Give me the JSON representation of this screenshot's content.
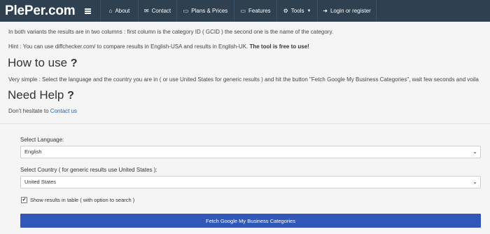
{
  "nav": {
    "brand": "PlePer.com",
    "items": [
      {
        "icon": "home-icon",
        "glyph": "⌂",
        "label": "About"
      },
      {
        "icon": "envelope-icon",
        "glyph": "✉",
        "label": "Contact"
      },
      {
        "icon": "money-icon",
        "glyph": "▭",
        "label": "Plans & Prices"
      },
      {
        "icon": "monitor-icon",
        "glyph": "▭",
        "label": "Features"
      },
      {
        "icon": "cogs-icon",
        "glyph": "⚙",
        "label": "Tools"
      },
      {
        "icon": "login-icon",
        "glyph": "➜",
        "label": "Login or register"
      }
    ]
  },
  "intro": {
    "line1": "In both variants the results are in two columns : first column is the category ID ( GCID ) the second one is the name of the category.",
    "hint_prefix": "Hint : You can use diffchecker.com/ to compare results in English-USA and results in English-UK.",
    "hint_bold": "The tool is free to use!"
  },
  "how_to": {
    "heading": "How to use",
    "q": "?",
    "text": "Very simple : Select the language and the country you are in ( or use United States for generic results ) and hit the button \"Fetch Google My Business Categories\", wait few seconds and voila"
  },
  "help": {
    "heading": "Need Help",
    "q": "?",
    "text_prefix": "Don't hesitate to",
    "link": "Contact us"
  },
  "form": {
    "language_label": "Select Language:",
    "language_value": "English",
    "country_label": "Select Country ( for generic results use United States ):",
    "country_value": "United States",
    "checkbox_label": "Show results in table ( with option to search )",
    "checkbox_checked": true,
    "button_label": "Fetch Google My Business Categories"
  }
}
